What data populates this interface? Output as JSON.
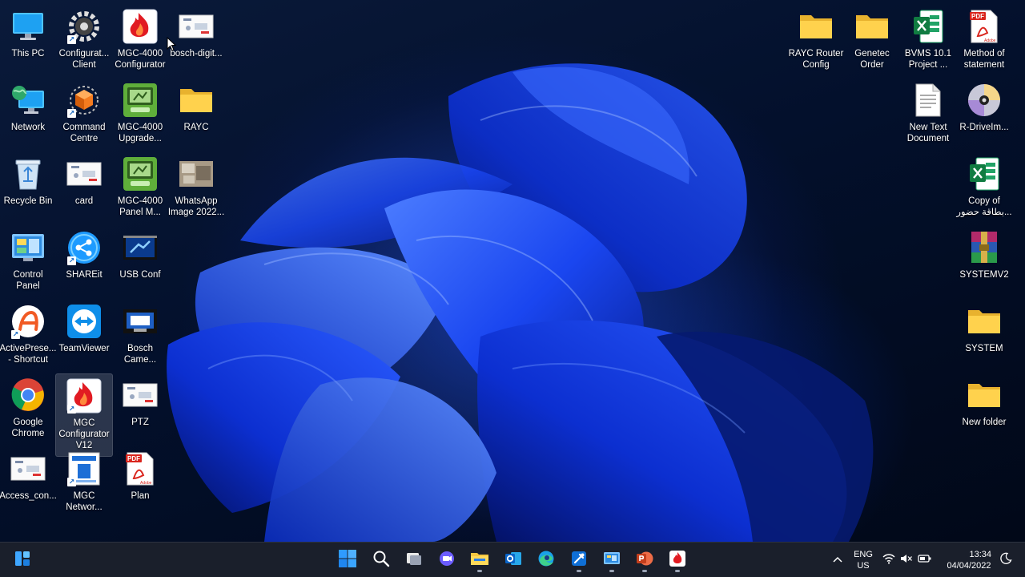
{
  "desktop": {
    "icons": [
      {
        "label": "This PC",
        "icon": "monitor-icon"
      },
      {
        "label": "Configurat...\nClient",
        "icon": "gear-icon"
      },
      {
        "label": "MGC-4000\nConfigurator",
        "icon": "flame-app-icon"
      },
      {
        "label": "bosch-digit...",
        "icon": "image-thumbnail-icon"
      },
      {
        "label": "Network",
        "icon": "network-globe-icon"
      },
      {
        "label": "Command\nCentre",
        "icon": "cube-app-icon"
      },
      {
        "label": "MGC-4000\nUpgrade...",
        "icon": "green-app-icon"
      },
      {
        "label": "RAYC",
        "icon": "folder-icon"
      },
      {
        "label": "Recycle Bin",
        "icon": "recycle-bin-icon"
      },
      {
        "label": "card",
        "icon": "image-thumbnail-icon"
      },
      {
        "label": "MGC-4000\nPanel M...",
        "icon": "green-app-icon"
      },
      {
        "label": "WhatsApp\nImage 2022...",
        "icon": "photo-thumbnail-icon"
      },
      {
        "label": "Control\nPanel",
        "icon": "control-panel-icon"
      },
      {
        "label": "SHAREit",
        "icon": "shareit-icon"
      },
      {
        "label": "USB Conf",
        "icon": "usb-app-icon"
      },
      {
        "label": "ActivePrese...\n- Shortcut",
        "icon": "activepresenter-icon"
      },
      {
        "label": "TeamViewer",
        "icon": "teamviewer-icon"
      },
      {
        "label": "Bosch\nCame...",
        "icon": "camera-app-icon"
      },
      {
        "label": "Google\nChrome",
        "icon": "chrome-icon"
      },
      {
        "label": "MGC\nConfigurator\nV12",
        "icon": "flame-app-icon"
      },
      {
        "label": "PTZ",
        "icon": "image-thumbnail-icon"
      },
      {
        "label": "Access_con...",
        "icon": "image-thumbnail-icon"
      },
      {
        "label": "MGC\nNetwor...",
        "icon": "blue-doc-app-icon"
      },
      {
        "label": "Plan",
        "icon": "pdf-icon"
      },
      {
        "label": "RAYC Router\nConfig",
        "icon": "folder-icon"
      },
      {
        "label": "Genetec\nOrder",
        "icon": "folder-icon"
      },
      {
        "label": "BVMS 10.1\nProject ...",
        "icon": "excel-icon"
      },
      {
        "label": "Method of\nstatement",
        "icon": "pdf-icon"
      },
      {
        "label": "New Text\nDocument",
        "icon": "text-document-icon"
      },
      {
        "label": "R-DriveIm...",
        "icon": "disc-icon"
      },
      {
        "label": "Copy of\nبطاقة حضور...",
        "icon": "excel-icon"
      },
      {
        "label": "SYSTEMV2",
        "icon": "winrar-icon"
      },
      {
        "label": "SYSTEM",
        "icon": "folder-icon"
      },
      {
        "label": "New folder",
        "icon": "folder-icon"
      }
    ]
  },
  "taskbar": {
    "widgets_icon": "widgets-icon",
    "pinned": [
      {
        "name": "start-button",
        "icon": "windows-logo-icon"
      },
      {
        "name": "search-button",
        "icon": "search-icon"
      },
      {
        "name": "task-view-button",
        "icon": "task-view-icon"
      },
      {
        "name": "chat-button",
        "icon": "chat-icon"
      },
      {
        "name": "file-explorer-button",
        "icon": "folder-icon"
      },
      {
        "name": "outlook-button",
        "icon": "outlook-icon"
      },
      {
        "name": "edge-button",
        "icon": "edge-icon"
      },
      {
        "name": "tool-app-button",
        "icon": "tool-app-icon"
      },
      {
        "name": "control-app-button",
        "icon": "control-panel-icon"
      },
      {
        "name": "powerpoint-button",
        "icon": "powerpoint-icon"
      },
      {
        "name": "mgc-app-button",
        "icon": "flame-app-icon"
      }
    ],
    "tray": {
      "lang_line1": "ENG",
      "lang_line2": "US",
      "time": "13:34",
      "date": "04/04/2022"
    }
  },
  "colors": {
    "accent": "#0a58ff",
    "taskbar_bg": "#1a1f2b",
    "folder": "#f6c741"
  }
}
